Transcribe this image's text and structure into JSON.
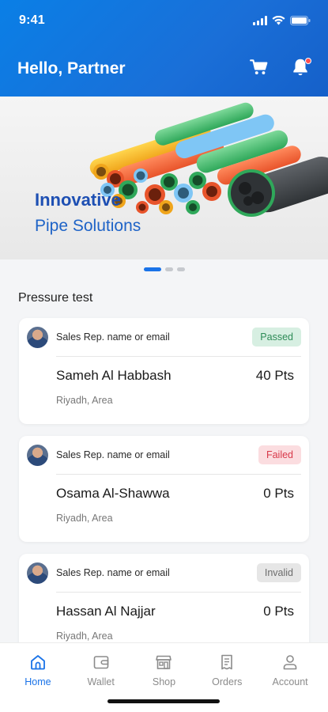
{
  "status_bar": {
    "time": "9:41"
  },
  "header": {
    "greeting": "Hello, Partner",
    "notification_dot_color": "#ff4d4f"
  },
  "banner": {
    "title": "Innovative",
    "subtitle": "Pipe Solutions",
    "slide_count": 3,
    "active_slide": 1
  },
  "section": {
    "title": "Pressure test"
  },
  "tests": [
    {
      "rep": "Sales Rep. name or email",
      "status": "Passed",
      "status_type": "passed",
      "name": "Sameh Al Habbash",
      "points": "40 Pts",
      "location": "Riyadh, Area"
    },
    {
      "rep": "Sales Rep. name or email",
      "status": "Failed",
      "status_type": "failed",
      "name": "Osama Al-Shawwa",
      "points": "0 Pts",
      "location": "Riyadh, Area"
    },
    {
      "rep": "Sales Rep. name or email",
      "status": "Invalid",
      "status_type": "invalid",
      "name": "Hassan Al Najjar",
      "points": "0 Pts",
      "location": "Riyadh, Area"
    }
  ],
  "tabbar": {
    "items": [
      {
        "label": "Home",
        "icon": "home-icon",
        "active": true
      },
      {
        "label": "Wallet",
        "icon": "wallet-icon",
        "active": false
      },
      {
        "label": "Shop",
        "icon": "shop-icon",
        "active": false
      },
      {
        "label": "Orders",
        "icon": "orders-icon",
        "active": false
      },
      {
        "label": "Account",
        "icon": "account-icon",
        "active": false
      }
    ]
  },
  "colors": {
    "primary": "#1a73e8",
    "passed": "#2e8b57",
    "failed": "#d8394a",
    "invalid": "#6c6c6c"
  }
}
